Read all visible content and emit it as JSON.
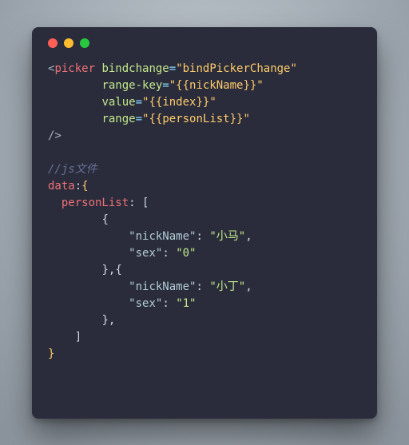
{
  "titlebar": {
    "red": "close",
    "yellow": "minimize",
    "green": "zoom"
  },
  "code": {
    "lt": "<",
    "gt": ">",
    "slash": "/",
    "eq": "=",
    "open_brace": "{",
    "close_brace": "}",
    "open_bracket": "[",
    "close_bracket": "]",
    "comma": ",",
    "colon": ":",
    "q": "\"",
    "tag_picker": "picker",
    "attr_bindchange": "bindchange",
    "val_bindchange": "\"bindPickerChange\"",
    "attr_rangekey": "range-key",
    "val_rangekey": "\"{{nickName}}\"",
    "attr_value": "value",
    "val_value": "\"{{index}}\"",
    "attr_range": "range",
    "val_range": "\"{{personList}}\"",
    "comment_js": "//js文件",
    "kw_data": "data",
    "prop_personlist": "personList",
    "key_nickname": "\"nickName\"",
    "key_sex": "\"sex\"",
    "val_name1": "\"小马\"",
    "val_sex1": "\"0\"",
    "val_name2": "\"小丁\"",
    "val_sex2": "\"1\""
  }
}
